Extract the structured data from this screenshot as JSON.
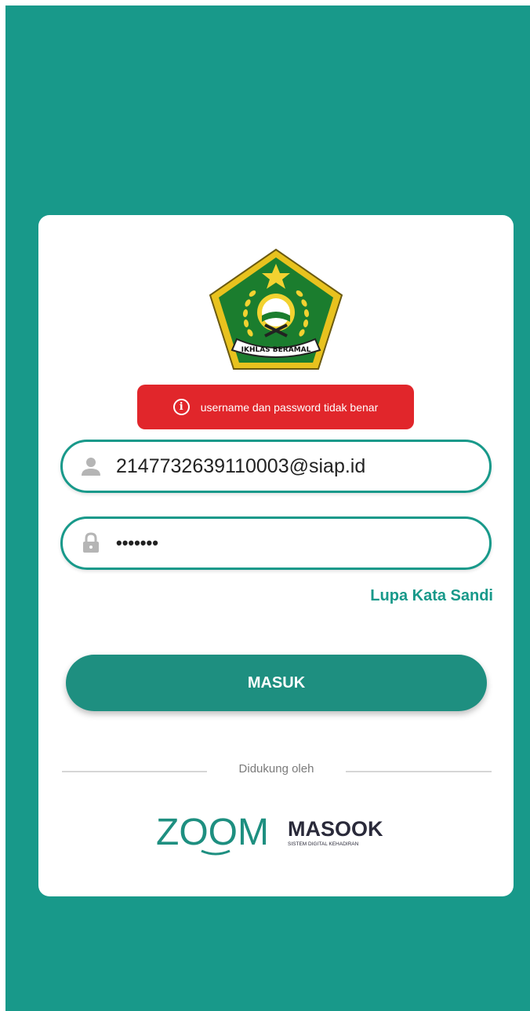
{
  "app": {
    "logo_motto": "IKHLAS BERAMAL"
  },
  "login": {
    "error_message": "username dan password tidak benar",
    "username_value": "2147732639110003@siap.id",
    "password_value": "•••••••",
    "forgot_password_label": "Lupa Kata Sandi",
    "submit_label": "MASUK"
  },
  "footer": {
    "supported_by_label": "Didukung oleh",
    "partner_logos": {
      "zoom": "ZOOM",
      "masook": "MASOOK",
      "masook_tagline": "SISTEM DIGITAL KEHADIRAN"
    }
  },
  "icons": {
    "error": "info-icon",
    "username": "user-icon",
    "password": "lock-icon"
  },
  "colors": {
    "background": "#18998a",
    "accent": "#18998a",
    "error": "#e1262b",
    "button": "#1e8f80"
  }
}
